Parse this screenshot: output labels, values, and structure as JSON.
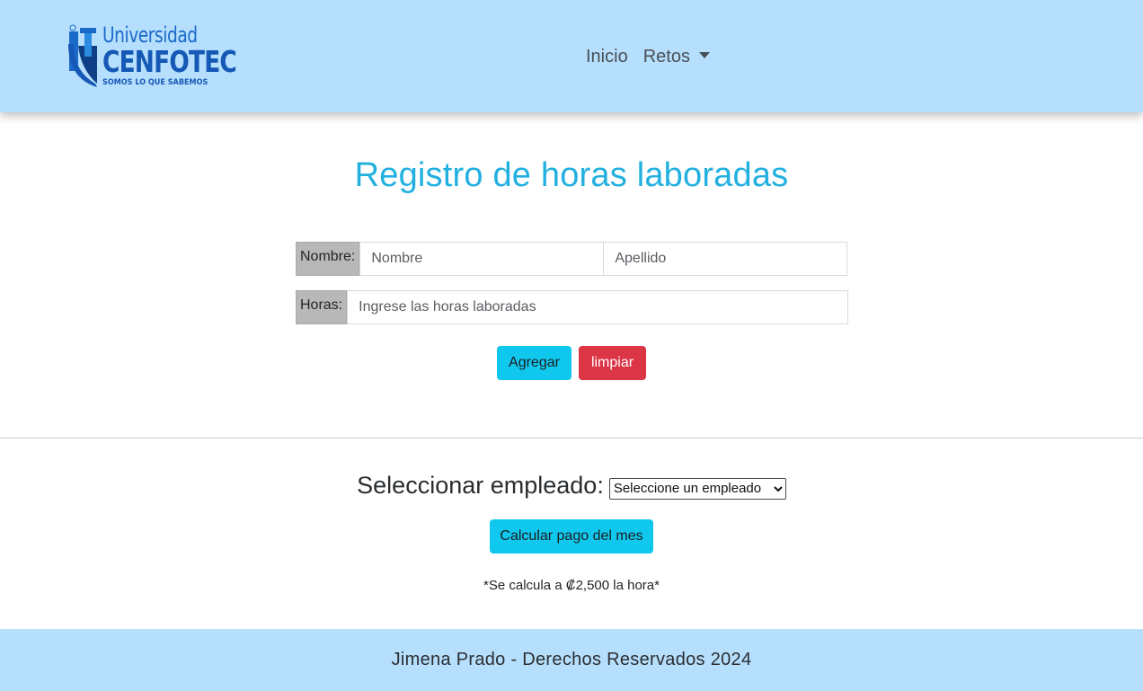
{
  "header": {
    "logo": {
      "line1": "Universidad",
      "line2": "CENFOTEC",
      "line3": "SOMOS LO QUE SABEMOS",
      "brand_color": "#1558b5"
    },
    "nav": {
      "inicio": "Inicio",
      "retos": "Retos"
    },
    "background_color": "#b6dffd"
  },
  "main": {
    "title": "Registro de horas laboradas",
    "form": {
      "nombre_label": "Nombre:",
      "nombre_placeholder": "Nombre",
      "apellido_placeholder": "Apellido",
      "horas_label": "Horas:",
      "horas_placeholder": "Ingrese las horas laboradas",
      "agregar_label": "Agregar",
      "limpiar_label": "limpiar"
    },
    "select_section": {
      "label": "Seleccionar empleado:",
      "selected_option": "Seleccione un empleado",
      "calcular_label": "Calcular pago del mes",
      "note": "*Se calcula a ₡2,500 la hora*"
    }
  },
  "footer": {
    "text": "Jimena Prado - Derechos Reservados 2024"
  },
  "colors": {
    "accent_cyan": "#10c8ee",
    "danger_red": "#dc3546",
    "title_color": "#22b0e0"
  }
}
